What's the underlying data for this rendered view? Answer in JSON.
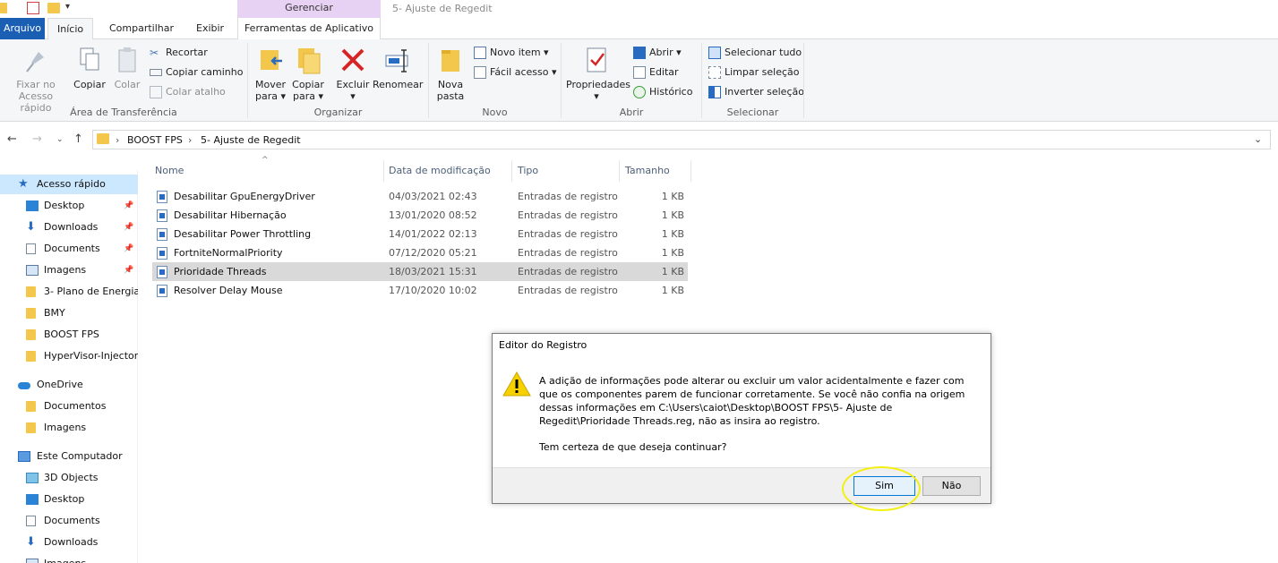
{
  "window": {
    "title": "5- Ajuste de Regedit",
    "contextual_tab_group": "Gerenciar"
  },
  "ribbon_tabs": {
    "arquivo": "Arquivo",
    "inicio": "Início",
    "compartilhar": "Compartilhar",
    "exibir": "Exibir",
    "ferramentas": "Ferramentas de Aplicativo"
  },
  "ribbon": {
    "clipboard": {
      "label": "Área de Transferência",
      "pin_line1": "Fixar no",
      "pin_line2": "Acesso rápido",
      "copy": "Copiar",
      "paste": "Colar",
      "cut": "Recortar",
      "copy_path": "Copiar caminho",
      "paste_shortcut": "Colar atalho"
    },
    "organize": {
      "label": "Organizar",
      "move_line1": "Mover",
      "move_line2": "para ▾",
      "copy_line1": "Copiar",
      "copy_line2": "para ▾",
      "delete_line1": "Excluir",
      "delete_line2": "▾",
      "rename": "Renomear"
    },
    "new": {
      "label": "Novo",
      "new_folder_line1": "Nova",
      "new_folder_line2": "pasta",
      "new_item": "Novo item ▾",
      "easy_access": "Fácil acesso ▾"
    },
    "open": {
      "label": "Abrir",
      "properties_line1": "Propriedades",
      "properties_line2": "▾",
      "open": "Abrir ▾",
      "edit": "Editar",
      "history": "Histórico"
    },
    "select": {
      "label": "Selecionar",
      "select_all": "Selecionar tudo",
      "select_none": "Limpar seleção",
      "invert": "Inverter seleção"
    }
  },
  "address": {
    "crumbs": [
      "BOOST FPS",
      "5- Ajuste de Regedit"
    ],
    "separator": "›"
  },
  "navpane": {
    "quick_access": "Acesso rápido",
    "quick_items": [
      {
        "label": "Desktop",
        "pinned": true
      },
      {
        "label": "Downloads",
        "pinned": true
      },
      {
        "label": "Documents",
        "pinned": true
      },
      {
        "label": "Imagens",
        "pinned": true
      },
      {
        "label": "3- Plano de Energia",
        "pinned": false
      },
      {
        "label": "BMY",
        "pinned": false
      },
      {
        "label": "BOOST FPS",
        "pinned": false
      },
      {
        "label": "HyperVisor-Injector",
        "pinned": false
      }
    ],
    "onedrive": "OneDrive",
    "onedrive_items": [
      "Documentos",
      "Imagens"
    ],
    "this_pc": "Este Computador",
    "pc_items": [
      "3D Objects",
      "Desktop",
      "Documents",
      "Downloads",
      "Imagens"
    ]
  },
  "columns": {
    "name": "Nome",
    "date": "Data de modificação",
    "type": "Tipo",
    "size": "Tamanho"
  },
  "files": [
    {
      "name": "Desabilitar GpuEnergyDriver",
      "date": "04/03/2021 02:43",
      "type": "Entradas de registro",
      "size": "1 KB"
    },
    {
      "name": "Desabilitar Hibernação",
      "date": "13/01/2020 08:52",
      "type": "Entradas de registro",
      "size": "1 KB"
    },
    {
      "name": "Desabilitar Power Throttling",
      "date": "14/01/2022 02:13",
      "type": "Entradas de registro",
      "size": "1 KB"
    },
    {
      "name": "FortniteNormalPriority",
      "date": "07/12/2020 05:21",
      "type": "Entradas de registro",
      "size": "1 KB"
    },
    {
      "name": "Prioridade Threads",
      "date": "18/03/2021 15:31",
      "type": "Entradas de registro",
      "size": "1 KB"
    },
    {
      "name": "Resolver Delay Mouse",
      "date": "17/10/2020 10:02",
      "type": "Entradas de registro",
      "size": "1 KB"
    }
  ],
  "dialog": {
    "title": "Editor do Registro",
    "message": "A adição de informações pode alterar ou excluir um valor acidentalmente e fazer com que os componentes parem de funcionar corretamente. Se você não confia na origem dessas informações em C:\\Users\\caiot\\Desktop\\BOOST FPS\\5- Ajuste de Regedit\\Prioridade Threads.reg, não as insira ao registro.",
    "question": "Tem certeza de que deseja continuar?",
    "yes": "Sim",
    "no": "Não"
  },
  "colors": {
    "accent": "#1a5fb4",
    "selection": "#cce8ff",
    "contextual_tab": "#e8d2f4",
    "highlight_annotation": "#f2ef12"
  }
}
